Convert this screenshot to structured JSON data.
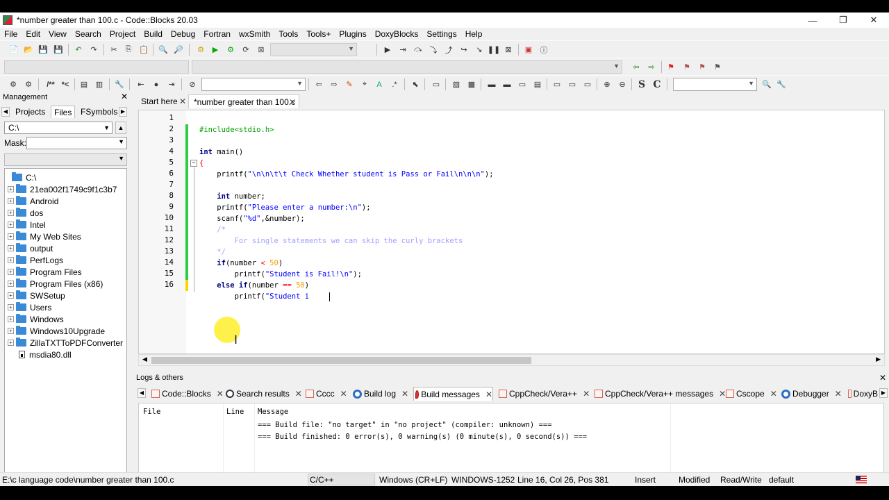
{
  "window": {
    "title": "*number greater than 100.c - Code::Blocks 20.03",
    "controls": {
      "minimize": "—",
      "maximize": "❐",
      "close": "✕"
    }
  },
  "menu": [
    "File",
    "Edit",
    "View",
    "Search",
    "Project",
    "Build",
    "Debug",
    "Fortran",
    "wxSmith",
    "Tools",
    "Tools+",
    "Plugins",
    "DoxyBlocks",
    "Settings",
    "Help"
  ],
  "toolbar": {
    "comment_label": "/**",
    "uncomment_label": "*<",
    "s_label": "S",
    "c_label": "C"
  },
  "management": {
    "title": "Management",
    "close": "✕",
    "tabs": [
      "Projects",
      "Files",
      "FSymbols"
    ],
    "active_tab": "Files",
    "path": "C:\\",
    "mask_label": "Mask:",
    "mask_value": "",
    "tree": [
      {
        "label": "C:\\",
        "type": "root"
      },
      {
        "label": "21ea002f1749c9f1c3b7",
        "type": "folder"
      },
      {
        "label": "Android",
        "type": "folder"
      },
      {
        "label": "dos",
        "type": "folder"
      },
      {
        "label": "Intel",
        "type": "folder"
      },
      {
        "label": "My Web Sites",
        "type": "folder"
      },
      {
        "label": "output",
        "type": "folder"
      },
      {
        "label": "PerfLogs",
        "type": "folder"
      },
      {
        "label": "Program Files",
        "type": "folder"
      },
      {
        "label": "Program Files (x86)",
        "type": "folder"
      },
      {
        "label": "SWSetup",
        "type": "folder"
      },
      {
        "label": "Users",
        "type": "folder"
      },
      {
        "label": "Windows",
        "type": "folder"
      },
      {
        "label": "Windows10Upgrade",
        "type": "folder"
      },
      {
        "label": "ZillaTXTToPDFConverter",
        "type": "folder"
      },
      {
        "label": "msdia80.dll",
        "type": "file"
      }
    ]
  },
  "editor": {
    "tabs": [
      {
        "label": "Start here",
        "active": false
      },
      {
        "label": "*number greater than 100.c",
        "active": true
      }
    ],
    "line_numbers": [
      "1",
      "2",
      "3",
      "4",
      "5",
      "6",
      "7",
      "8",
      "9",
      "10",
      "11",
      "12",
      "13",
      "14",
      "15",
      "16"
    ],
    "lines": {
      "l1": "#include<stdio.h>",
      "l3_kw": "int",
      "l3_rest": " main()",
      "l4": "{",
      "l5_fn": "    printf(",
      "l5_str": "\"\\n\\n\\t\\t Check Whether student is Pass or Fail\\n\\n\\n\"",
      "l5_end": ");",
      "l7_kw": "    int",
      "l7_rest": " number;",
      "l8_fn": "    printf(",
      "l8_str": "\"Please enter a number:\\n\"",
      "l8_end": ");",
      "l9_fn": "    scanf(",
      "l9_str": "\"%d\"",
      "l9_end": ",&number);",
      "l10": "    /*",
      "l11": "        For single statements we can skip the curly brackets",
      "l12": "    */",
      "l13_kw": "    if",
      "l13_a": "(number ",
      "l13_op": "<",
      "l13_num": " 50",
      "l13_end": ")",
      "l14_fn": "        printf(",
      "l14_str": "\"Student is Fail!\\n\"",
      "l14_end": ");",
      "l15_kw": "    else if",
      "l15_a": "(number ",
      "l15_op": "==",
      "l15_num": " 50",
      "l15_end": ")",
      "l16_fn": "        printf(",
      "l16_str": "\"Student i"
    }
  },
  "logs": {
    "title": "Logs & others",
    "close": "✕",
    "tabs": [
      "Code::Blocks",
      "Search results",
      "Cccc",
      "Build log",
      "Build messages",
      "CppCheck/Vera++",
      "CppCheck/Vera++ messages",
      "Cscope",
      "Debugger",
      "DoxyB"
    ],
    "active_tab": "Build messages",
    "headers": {
      "file": "File",
      "line": "Line",
      "message": "Message"
    },
    "messages": [
      "=== Build file: \"no target\" in \"no project\" (compiler: unknown) ===",
      "=== Build finished: 0 error(s), 0 warning(s) (0 minute(s), 0 second(s)) ==="
    ]
  },
  "status": {
    "path": "E:\\c language code\\number greater than 100.c",
    "language": "C/C++",
    "eol": "Windows (CR+LF)",
    "encoding": "WINDOWS-1252",
    "position": "Line 16, Col 26, Pos 381",
    "mode": "Insert",
    "modified": "Modified",
    "access": "Read/Write",
    "profile": "default"
  },
  "colors": {
    "preprocessor": "#00a000",
    "keyword": "#000080",
    "string": "#0000ff",
    "comment": "#a0a0ff",
    "number": "#f0a000",
    "operator": "#ff0000",
    "change_bar": "#2ecc40"
  }
}
